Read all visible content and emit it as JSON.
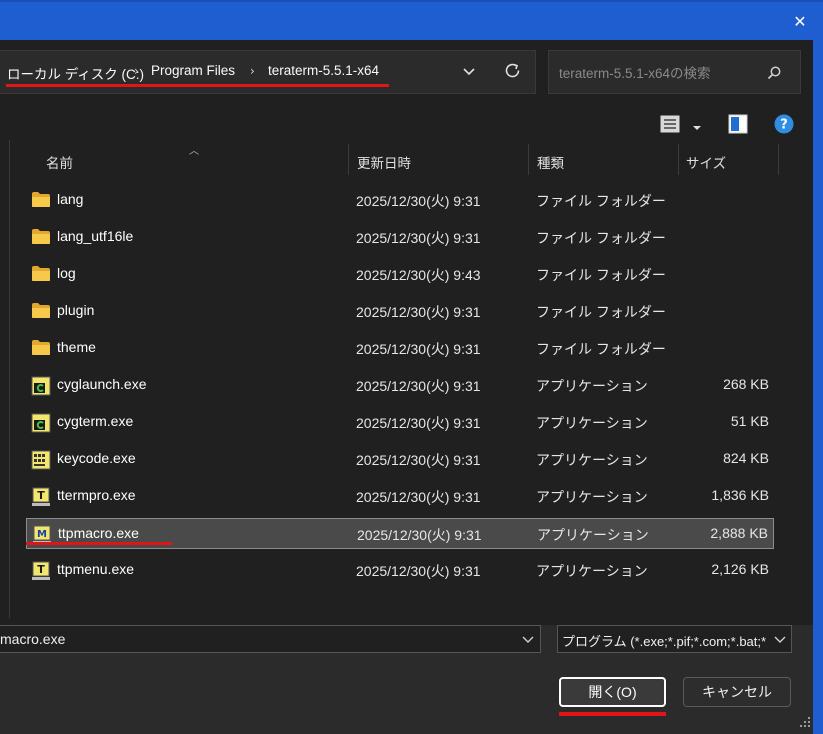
{
  "window": {
    "close_glyph": "✕"
  },
  "address": {
    "crumbs": [
      "ローカル ディスク (C:)",
      "Program Files",
      "teraterm-5.5.1-x64"
    ],
    "separator": "›"
  },
  "search": {
    "placeholder": "teraterm-5.5.1-x64の検索"
  },
  "toolbar": {
    "view_icon": "view-menu-icon",
    "preview_icon": "preview-pane-icon",
    "help_icon": "help-icon"
  },
  "columns": {
    "name": "名前",
    "modified": "更新日時",
    "type": "種類",
    "size": "サイズ"
  },
  "files": [
    {
      "name": "lang",
      "modified": "2025/12/30(火) 9:31",
      "type": "ファイル フォルダー",
      "size": "",
      "icon": "folder-icon"
    },
    {
      "name": "lang_utf16le",
      "modified": "2025/12/30(火) 9:31",
      "type": "ファイル フォルダー",
      "size": "",
      "icon": "folder-icon"
    },
    {
      "name": "log",
      "modified": "2025/12/30(火) 9:43",
      "type": "ファイル フォルダー",
      "size": "",
      "icon": "folder-icon"
    },
    {
      "name": "plugin",
      "modified": "2025/12/30(火) 9:31",
      "type": "ファイル フォルダー",
      "size": "",
      "icon": "folder-icon"
    },
    {
      "name": "theme",
      "modified": "2025/12/30(火) 9:31",
      "type": "ファイル フォルダー",
      "size": "",
      "icon": "folder-icon"
    },
    {
      "name": "cyglaunch.exe",
      "modified": "2025/12/30(火) 9:31",
      "type": "アプリケーション",
      "size": "268 KB",
      "icon": "cygwin-icon"
    },
    {
      "name": "cygterm.exe",
      "modified": "2025/12/30(火) 9:31",
      "type": "アプリケーション",
      "size": "51 KB",
      "icon": "cygwin-icon"
    },
    {
      "name": "keycode.exe",
      "modified": "2025/12/30(火) 9:31",
      "type": "アプリケーション",
      "size": "824 KB",
      "icon": "keycode-icon"
    },
    {
      "name": "ttermpro.exe",
      "modified": "2025/12/30(火) 9:31",
      "type": "アプリケーション",
      "size": "1,836 KB",
      "icon": "teraterm-icon"
    },
    {
      "name": "ttpmacro.exe",
      "modified": "2025/12/30(火) 9:31",
      "type": "アプリケーション",
      "size": "2,888 KB",
      "icon": "macro-icon",
      "selected": true
    },
    {
      "name": "ttpmenu.exe",
      "modified": "2025/12/30(火) 9:31",
      "type": "アプリケーション",
      "size": "2,126 KB",
      "icon": "teraterm-icon"
    }
  ],
  "footer": {
    "filename_value": "macro.exe",
    "filetype_value": "プログラム (*.exe;*.pif;*.com;*.bat;*",
    "open_label": "開く(O)",
    "cancel_label": "キャンセル"
  },
  "colors": {
    "accent": "#1f5ed1",
    "highlight_red": "#e01515",
    "folder": "#f4c542",
    "help": "#2f8de4"
  }
}
